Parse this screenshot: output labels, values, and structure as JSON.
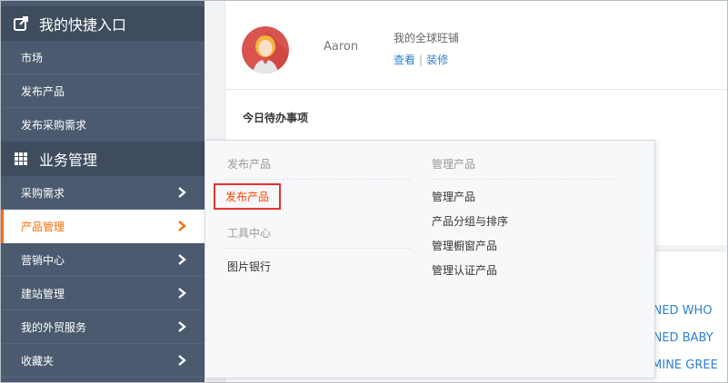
{
  "sidebar": {
    "quick_entry": {
      "title": "我的快捷入口",
      "icon": "external-link-icon"
    },
    "quick_items": [
      {
        "label": "市场"
      },
      {
        "label": "发布产品"
      },
      {
        "label": "发布采购需求"
      }
    ],
    "business": {
      "title": "业务管理",
      "icon": "grid-icon"
    },
    "business_items": [
      {
        "label": "采购需求"
      },
      {
        "label": "产品管理",
        "active": true
      },
      {
        "label": "营销中心"
      },
      {
        "label": "建站管理"
      },
      {
        "label": "我的外贸服务"
      },
      {
        "label": "收藏夹"
      }
    ]
  },
  "profile": {
    "name": "Aaron",
    "shop_title": "我的全球旺铺",
    "link_view": "查看",
    "link_sep": "|",
    "link_decorate": "装修"
  },
  "todo": {
    "title": "今日待办事项"
  },
  "flyout": {
    "publish": {
      "heading": "发布产品",
      "items": [
        "发布产品"
      ]
    },
    "tools": {
      "heading": "工具中心",
      "items": [
        "图片银行"
      ]
    },
    "manage": {
      "heading": "管理产品",
      "items": [
        "管理产品",
        "产品分组与排序",
        "管理橱窗产品",
        "管理认证产品"
      ]
    }
  },
  "products": [
    "ANNED WHO",
    "ANNED BABY",
    "ASMINE GREE"
  ],
  "colors": {
    "accent": "#ff6a00",
    "link": "#2f80cf",
    "sidebar": "#4b5a6e",
    "highlight_border": "#e8322d"
  }
}
